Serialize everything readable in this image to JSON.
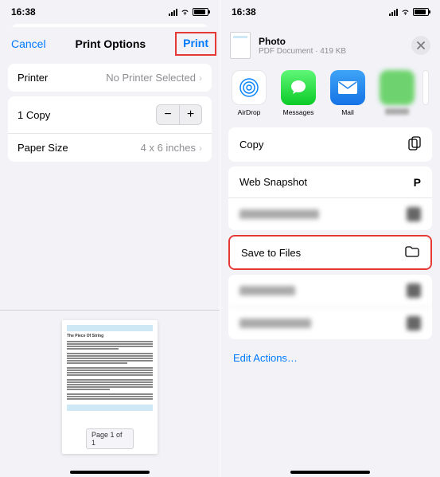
{
  "statusbar": {
    "time": "16:38"
  },
  "left": {
    "header": {
      "cancel": "Cancel",
      "title": "Print Options",
      "print": "Print"
    },
    "printer": {
      "label": "Printer",
      "value": "No Printer Selected"
    },
    "copies": {
      "label": "1 Copy"
    },
    "paper": {
      "label": "Paper Size",
      "value": "4 x 6 inches"
    },
    "preview": {
      "doc_title": "The Piece Of String",
      "page_badge": "Page 1 of 1"
    }
  },
  "right": {
    "file": {
      "name": "Photo",
      "meta": "PDF Document · 419 KB"
    },
    "targets": {
      "airdrop": "AirDrop",
      "messages": "Messages",
      "mail": "Mail"
    },
    "actions": {
      "copy": "Copy",
      "web_snapshot": "Web Snapshot",
      "save_to_files": "Save to Files"
    },
    "edit_actions": "Edit Actions…"
  }
}
